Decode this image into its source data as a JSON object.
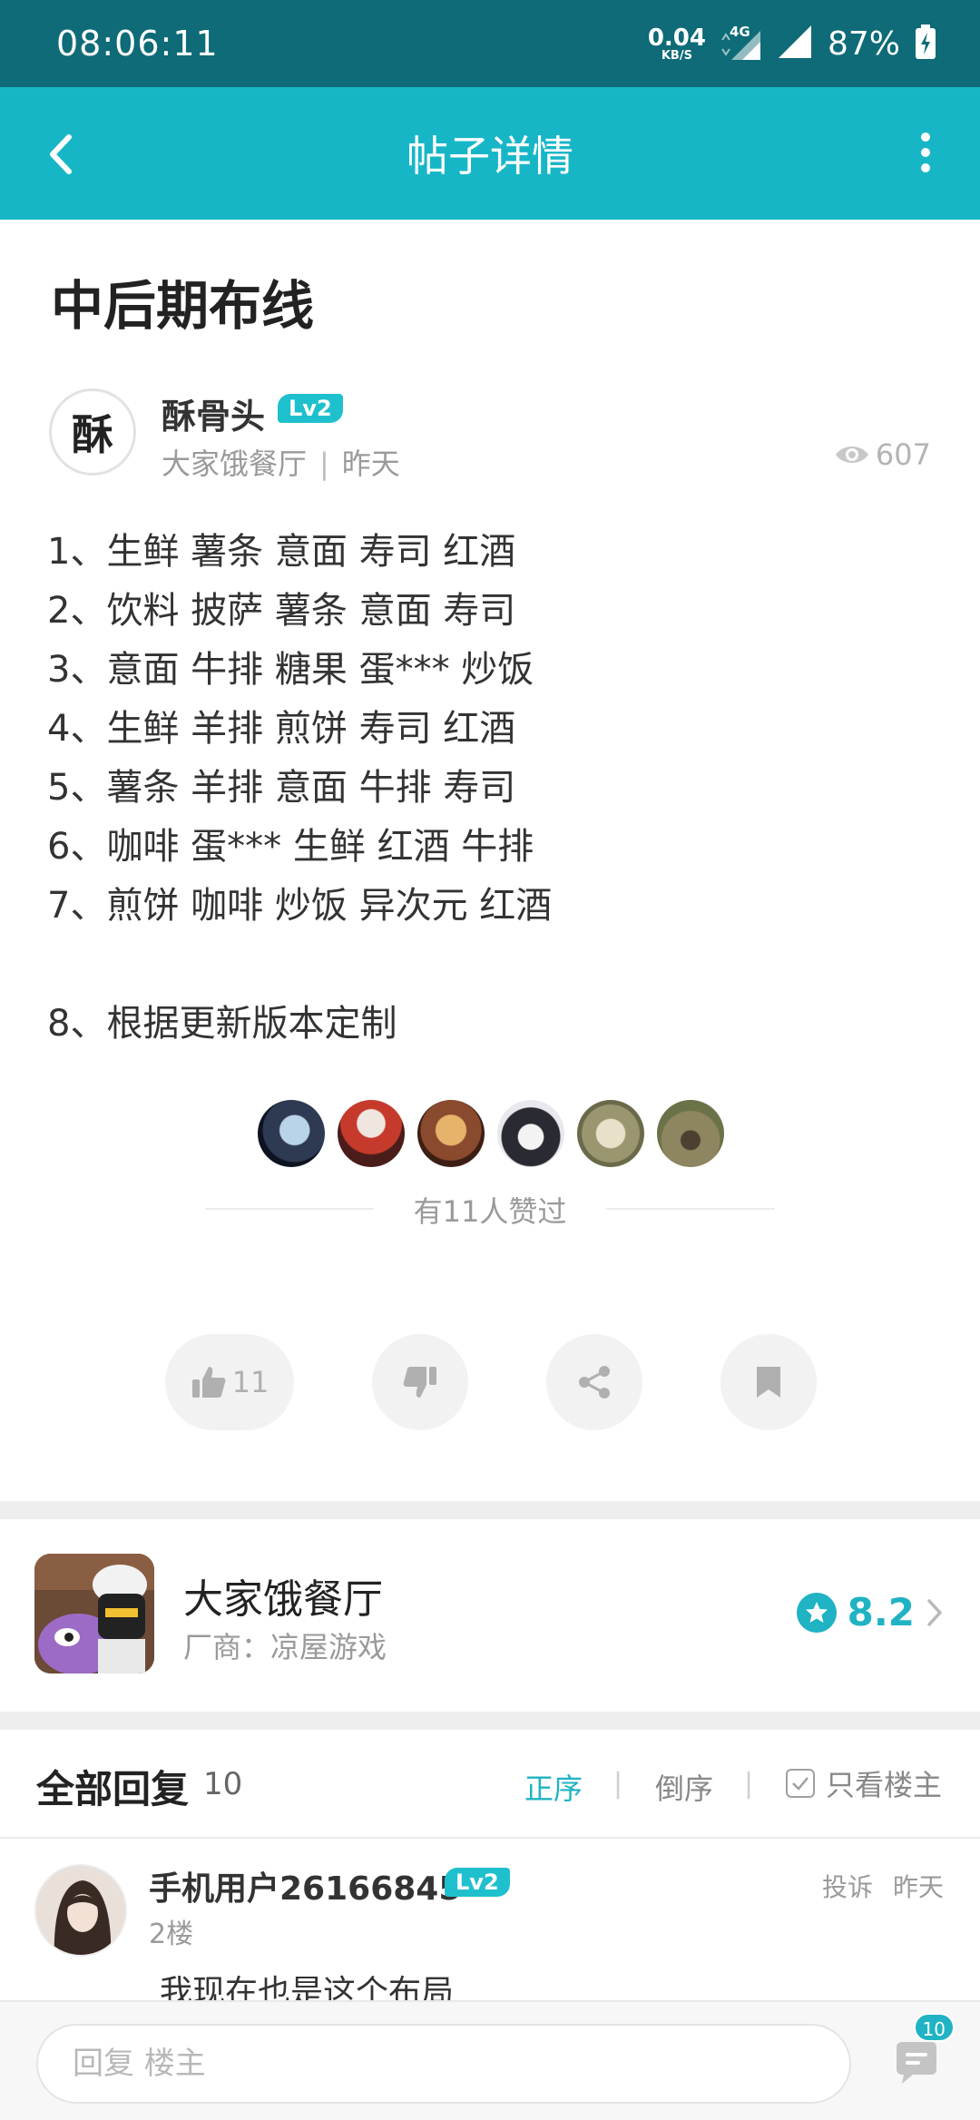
{
  "status_bar": {
    "time": "08:06:11",
    "net_speed": "0.04",
    "net_unit": "KB/S",
    "network": "4G",
    "battery": "87%"
  },
  "header": {
    "title": "帖子详情",
    "back_icon": "chevron-left-icon",
    "menu_icon": "more-vertical-icon"
  },
  "post": {
    "title": "中后期布线",
    "author": {
      "name": "酥骨头",
      "level": "Lv2",
      "avatar_text": "酥",
      "forum": "大家饿餐厅",
      "separator": "|",
      "time": "昨天"
    },
    "views": "607",
    "body_lines": [
      "1、生鲜 薯条 意面 寿司 红酒",
      "2、饮料 披萨 薯条 意面 寿司",
      "3、意面 牛排 糖果 蛋*** 炒饭",
      "4、生鲜 羊排 煎饼 寿司 红酒",
      "5、薯条 羊排 意面 牛排 寿司",
      "6、咖啡 蛋*** 生鲜 红酒 牛排",
      "7、煎饼 咖啡 炒饭 异次元 红酒",
      "",
      "8、根据更新版本定制"
    ],
    "likers_text": "有11人赞过",
    "like_count": "11"
  },
  "game": {
    "name": "大家饿餐厅",
    "vendor": "厂商：凉屋游戏",
    "score": "8.2"
  },
  "replies": {
    "title": "全部回复",
    "count": "10",
    "sort_asc": "正序",
    "sort_desc": "倒序",
    "sort_sep": "|",
    "only_op": "只看楼主",
    "items": [
      {
        "user": "手机用户26166845",
        "level": "Lv2",
        "floor": "2楼",
        "report": "投诉",
        "time": "昨天",
        "text": "我现在也是这个布局"
      }
    ]
  },
  "bottom_bar": {
    "placeholder": "回复  楼主",
    "comment_count": "10"
  },
  "colors": {
    "status_bar": "#0e6b77",
    "header": "#17b6c7",
    "accent": "#1fb3c4"
  }
}
